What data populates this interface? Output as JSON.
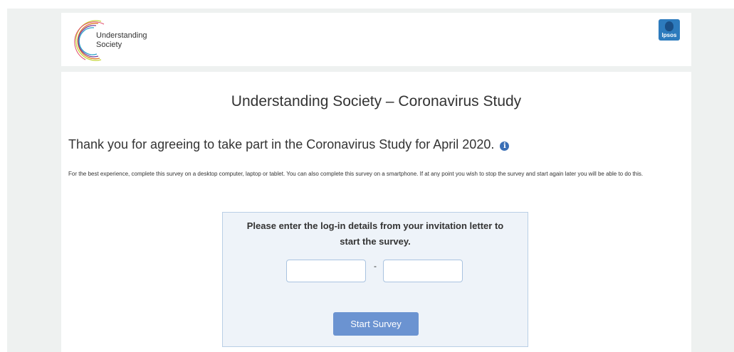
{
  "header": {
    "logo_text": "Understanding Society",
    "partner_logo_text": "Ipsos"
  },
  "main": {
    "study_title": "Understanding Society – Coronavirus Study",
    "thanks_text": "Thank you for agreeing to take part in the Coronavirus Study for April 2020.",
    "info_icon": "info-icon",
    "intro_text": "For the best experience, complete this survey on a desktop computer, laptop or tablet. You can also complete this survey on a smartphone. If at any point you wish to stop the survey and start again later you will be able to do this."
  },
  "login": {
    "prompt": "Please enter the log-in details from your invitation letter to start the survey.",
    "field1_value": "",
    "separator": "-",
    "field2_value": "",
    "start_label": "Start Survey"
  },
  "colors": {
    "accent": "#6b93d1",
    "box_background": "#eef3f9",
    "page_background": "#eef1f0"
  }
}
